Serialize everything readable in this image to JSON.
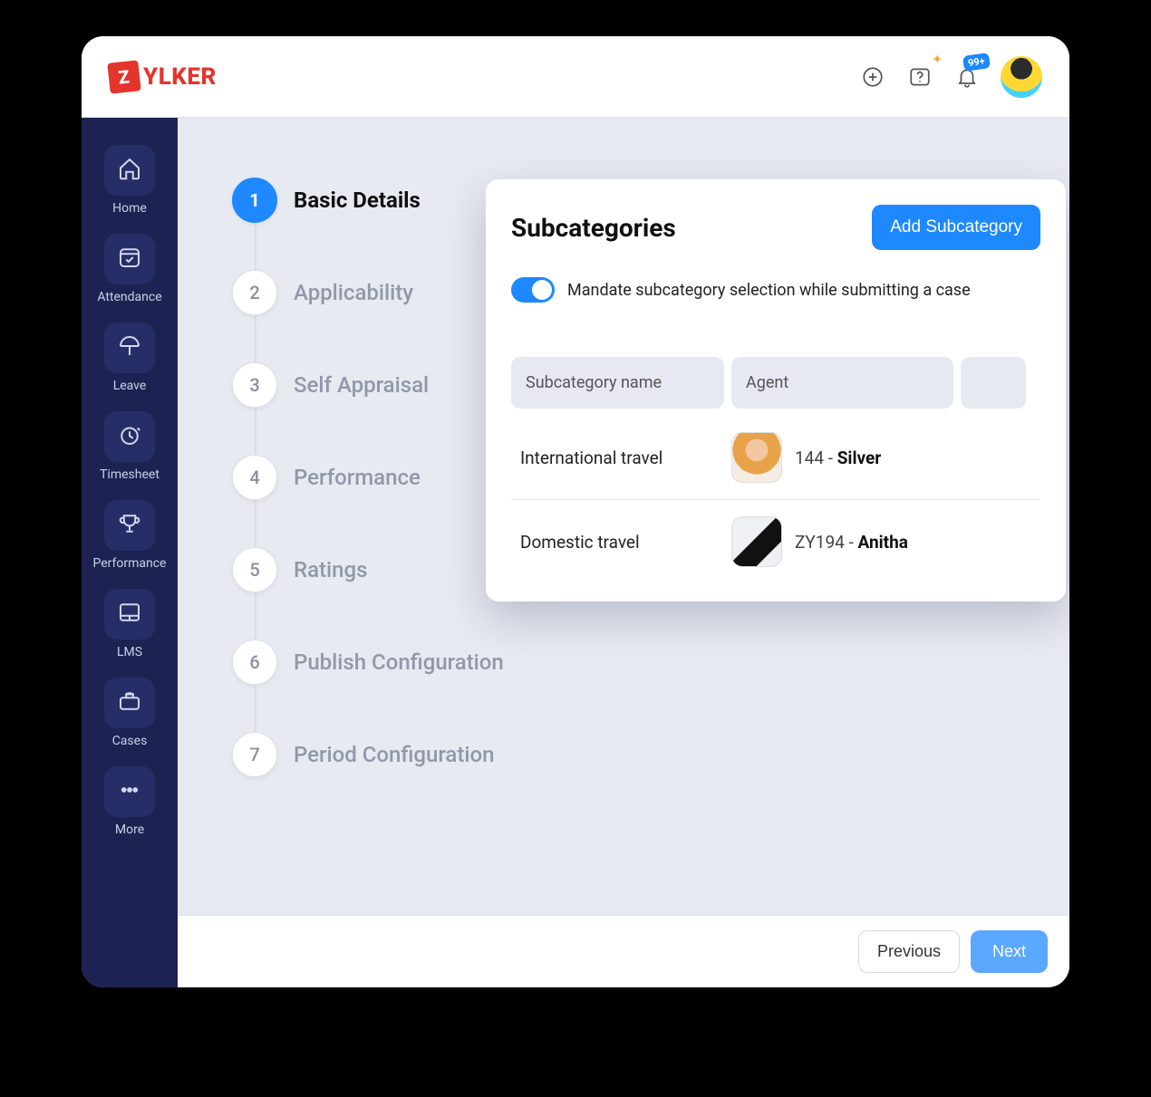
{
  "brand": {
    "mark": "Z",
    "name": "YLKER"
  },
  "header": {
    "notification_badge": "99+"
  },
  "sidebar": {
    "items": [
      {
        "label": "Home"
      },
      {
        "label": "Attendance"
      },
      {
        "label": "Leave"
      },
      {
        "label": "Timesheet"
      },
      {
        "label": "Performance"
      },
      {
        "label": "LMS"
      },
      {
        "label": "Cases"
      },
      {
        "label": "More"
      }
    ]
  },
  "steps": [
    {
      "num": "1",
      "label": "Basic Details",
      "active": true
    },
    {
      "num": "2",
      "label": "Applicability"
    },
    {
      "num": "3",
      "label": "Self Appraisal"
    },
    {
      "num": "4",
      "label": "Performance"
    },
    {
      "num": "5",
      "label": "Ratings"
    },
    {
      "num": "6",
      "label": "Publish Configuration"
    },
    {
      "num": "7",
      "label": "Period Configuration"
    }
  ],
  "panel": {
    "title": "Subcategories",
    "add_button": "Add Subcategory",
    "toggle_label": "Mandate subcategory selection while submitting a case",
    "columns": {
      "c1": "Subcategory name",
      "c2": "Agent"
    },
    "rows": [
      {
        "name": "International travel",
        "agent_code": "144",
        "agent_name": "Silver"
      },
      {
        "name": "Domestic travel",
        "agent_code": "ZY194",
        "agent_name": "Anitha"
      }
    ]
  },
  "footer": {
    "previous": "Previous",
    "next": "Next"
  }
}
